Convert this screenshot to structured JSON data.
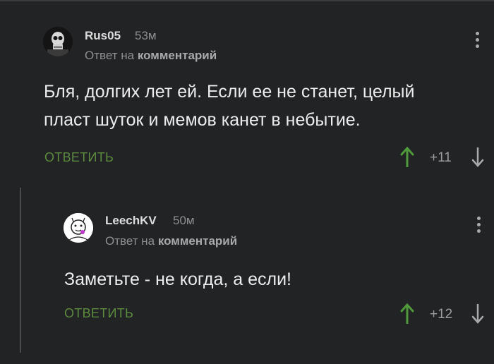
{
  "comments": [
    {
      "author": "Rus05",
      "age": "53м",
      "reply_prefix": "Ответ на",
      "reply_target": "комментарий",
      "text_line1": "Бля, долгих лет ей. Если ее не станет, целый",
      "text_line2": "пласт шуток и мемов канет в небытие.",
      "reply_label": "ОТВЕТИТЬ",
      "rating": "+11"
    },
    {
      "author": "LeechKV",
      "age": "50м",
      "reply_prefix": "Ответ на",
      "reply_target": "комментарий",
      "text_line1": "Заметьте - не когда, а если!",
      "reply_label": "ОТВЕТИТЬ",
      "rating": "+12"
    }
  ],
  "colors": {
    "background": "#222325",
    "accent_green": "#5c8a3e",
    "upvote": "#4f9a3a",
    "muted": "#8d8f91"
  },
  "icons": [
    "more-vert-icon",
    "arrow-up-icon",
    "arrow-down-icon"
  ]
}
